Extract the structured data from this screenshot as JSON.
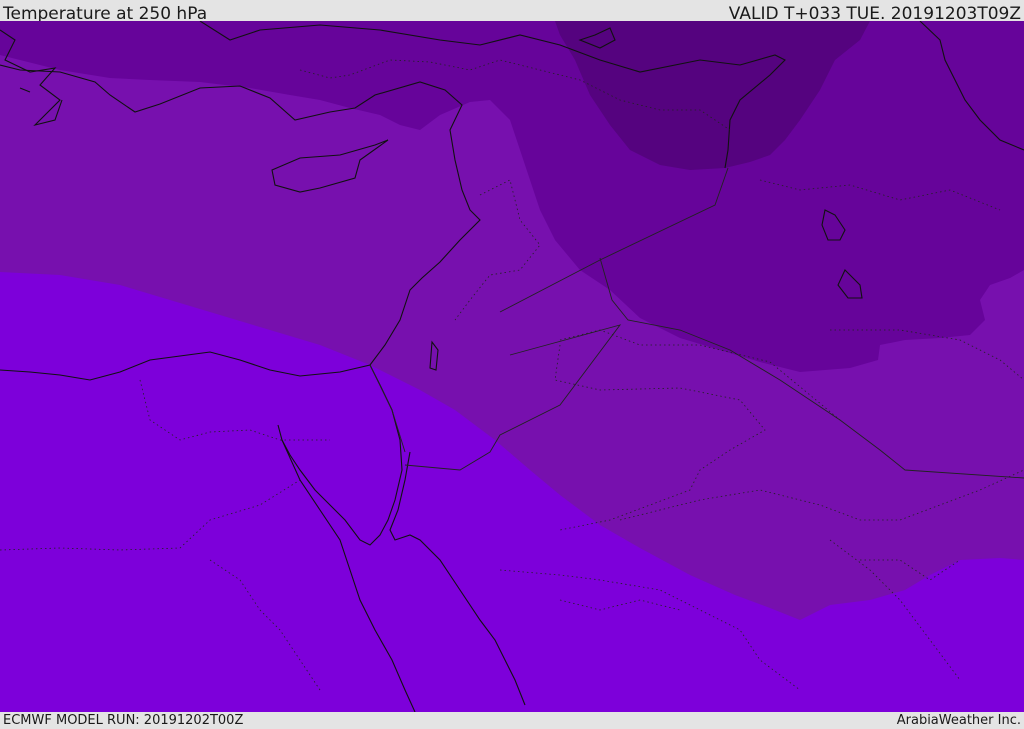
{
  "header": {
    "title": "Temperature at 250 hPa",
    "valid": "VALID T+033 TUE. 20191203T09Z"
  },
  "footer": {
    "model_run": "ECMWF MODEL RUN: 20191202T00Z",
    "credit": "ArabiaWeather Inc."
  },
  "map": {
    "colors": {
      "band_south": "#7d00da",
      "band_middle": "#7710ae",
      "band_north": "#66049a",
      "band_coldest": "#55037f",
      "coast_line": "#111111",
      "border_line": "#222222"
    }
  }
}
